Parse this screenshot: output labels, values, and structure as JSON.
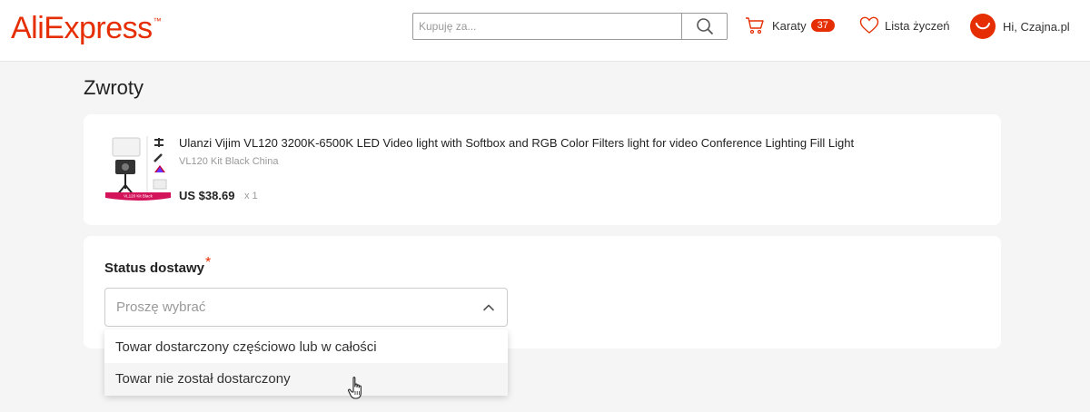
{
  "header": {
    "logo": "AliExpress",
    "search_placeholder": "Kupuję za...",
    "cart_label": "Karaty",
    "cart_count": "37",
    "wishlist_label": "Lista życzeń",
    "user_greeting": "Hi, Czajna.pl"
  },
  "page": {
    "title": "Zwroty"
  },
  "product": {
    "title": "Ulanzi Vijim VL120 3200K-6500K LED Video light with Softbox and RGB Color Filters light for video Conference Lighting Fill Light",
    "variant": "VL120 Kit Black China",
    "price": "US $38.69",
    "quantity": "x 1",
    "thumb_label": "VL120 Kit Black"
  },
  "status_field": {
    "label": "Status dostawy",
    "required_mark": "*",
    "placeholder": "Proszę wybrać",
    "options": [
      "Towar dostarczony częściowo lub w całości",
      "Towar nie został dostarczony"
    ]
  },
  "colors": {
    "brand": "#e62e04",
    "background": "#f5f5f5"
  }
}
